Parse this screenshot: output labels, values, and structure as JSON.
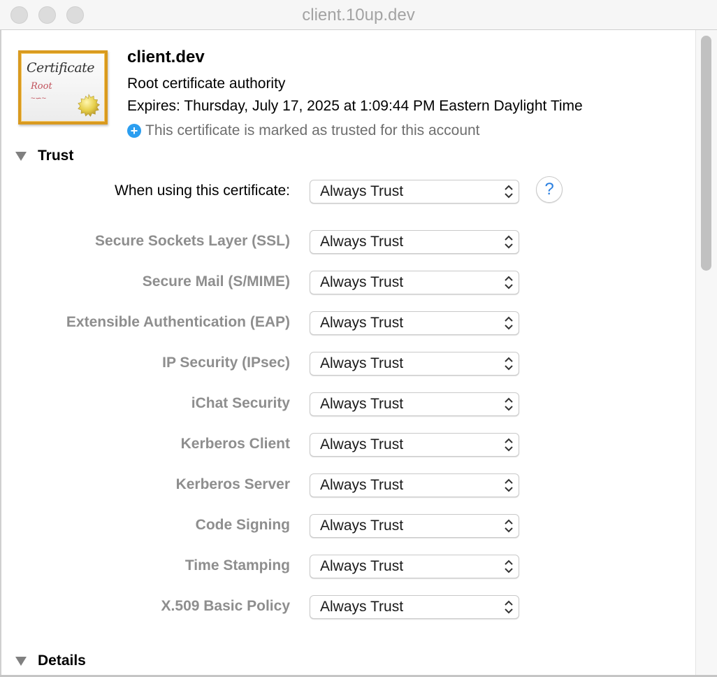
{
  "window": {
    "title": "client.10up.dev",
    "traffic_lights": [
      "close",
      "minimize",
      "zoom"
    ]
  },
  "certificate": {
    "icon": {
      "word": "Certificate",
      "sub": "Root",
      "flourish": "~∽~"
    },
    "name": "client.dev",
    "kind": "Root certificate authority",
    "expires": "Expires: Thursday, July 17, 2025 at 1:09:44 PM Eastern Daylight Time",
    "trust_note": "This certificate is marked as trusted for this account",
    "trust_note_icon": "plus-circle-icon",
    "accent_color": "#2b9ef0"
  },
  "trust_section": {
    "title": "Trust",
    "expanded": true,
    "main_row": {
      "label": "When using this certificate:",
      "value": "Always Trust"
    },
    "help_label": "?",
    "rows": [
      {
        "label": "Secure Sockets Layer (SSL)",
        "value": "Always Trust"
      },
      {
        "label": "Secure Mail (S/MIME)",
        "value": "Always Trust"
      },
      {
        "label": "Extensible Authentication (EAP)",
        "value": "Always Trust"
      },
      {
        "label": "IP Security (IPsec)",
        "value": "Always Trust"
      },
      {
        "label": "iChat Security",
        "value": "Always Trust"
      },
      {
        "label": "Kerberos Client",
        "value": "Always Trust"
      },
      {
        "label": "Kerberos Server",
        "value": "Always Trust"
      },
      {
        "label": "Code Signing",
        "value": "Always Trust"
      },
      {
        "label": "Time Stamping",
        "value": "Always Trust"
      },
      {
        "label": "X.509 Basic Policy",
        "value": "Always Trust"
      }
    ]
  },
  "details_section": {
    "title": "Details",
    "expanded": true
  }
}
